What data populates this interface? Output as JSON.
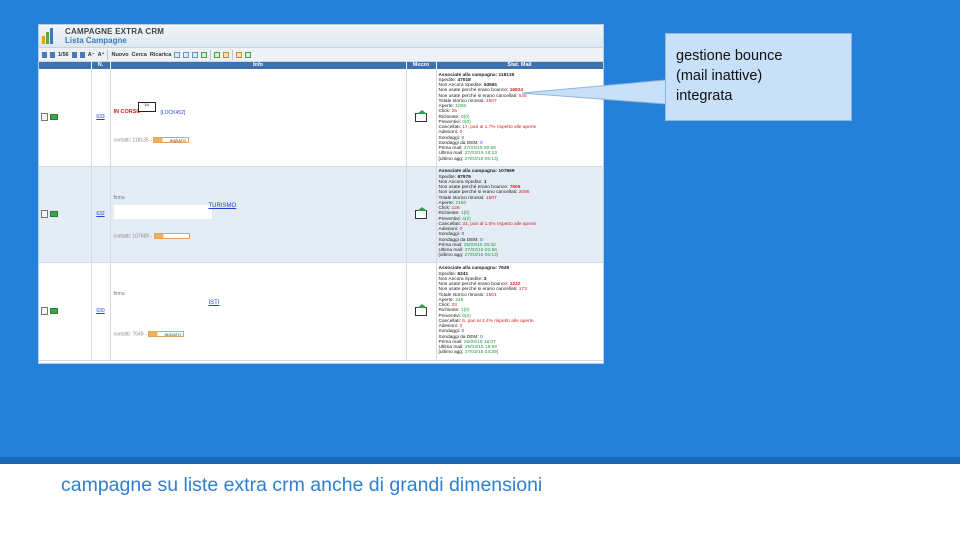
{
  "slide": {
    "callout_lines": [
      "gestione bounce",
      "(mail inattive)",
      "integrata"
    ],
    "caption": "campagne su liste extra crm anche di grandi dimensioni",
    "bg_color": "#2480d8"
  },
  "app": {
    "title": "CAMPAGNE EXTRA CRM",
    "subtitle": "Lista Campagne",
    "toolbar": {
      "page": "1/56",
      "new": "Nuovo",
      "search": "Cerca",
      "reload": "Ricarica"
    },
    "columns": {
      "num": "N.",
      "info": "Info",
      "medium": "Mezzo",
      "stats": "Stat. Mail"
    }
  },
  "rows": [
    {
      "id": "633",
      "status": "IN CORSO",
      "badge": "1/4",
      "lock": "[LOCK452]",
      "contacts": "contatti: 118135 -",
      "bar_label": "INIZIATO",
      "stats": {
        "associated_label": "Associate alla campagna: ",
        "associated": "118135",
        "sent_label": "Spedite: ",
        "sent": "47018",
        "not_sent_label": "Non Ancora Spedite: ",
        "not_sent": "53591",
        "bounce_label": "Non usate perché erano bounce: ",
        "bounce": "16824",
        "cancelled_label": "Non usate perché si erano cancellati: ",
        "cancelled": "545",
        "removed_label": "Totale storico rimossi: ",
        "removed": "1507",
        "opened_label": "Aperte: ",
        "opened": "1006",
        "click_label": "Click: ",
        "click": "25",
        "requests_label": "Richieste: ",
        "requests": "0(0)",
        "quotes_label": "Preventivi: ",
        "quotes": "0(0)",
        "unsub_label": "Cancellati: ",
        "unsub": "17, pari al 1.7% rispetto alle aperte",
        "joins_label": "Adesioni: ",
        "joins": "0",
        "polls_label": "Sondaggi: ",
        "polls": "0",
        "dem_polls_label": "Sondaggi da DEM: ",
        "dem_polls": "0",
        "first_label": "Prima mail: ",
        "first": "27/03/15 00:59",
        "last_label": "Ultima mail: ",
        "last": "27/03/15 18:13",
        "updated_label": "[ultimo agg: ",
        "updated": "27/03/15 06:13]"
      }
    },
    {
      "id": "632",
      "firma": "firma",
      "link_tail": "TURISMO",
      "contacts": "contatti: 107669 -",
      "stats": {
        "associated_label": "Associate alla campagna: ",
        "associated": "107669",
        "sent_label": "Spedite: ",
        "sent": "97979",
        "not_sent_label": "Non Ancora Spedite: ",
        "not_sent": "1",
        "bounce_label": "Non usate perché erano bounce: ",
        "bounce": "7606",
        "cancelled_label": "Non usate perché si erano cancellati: ",
        "cancelled": "2086",
        "removed_label": "Totale storico rimossi: ",
        "removed": "1507",
        "opened_label": "Aperte: ",
        "opened": "2156",
        "click_label": "Click: ",
        "click": "128",
        "requests_label": "Richieste: ",
        "requests": "1(0)",
        "quotes_label": "Preventivi: ",
        "quotes": "4(2)",
        "unsub_label": "Cancellati: ",
        "unsub": "33, pari al 1.5% rispetto alle aperte",
        "joins_label": "Adesioni: ",
        "joins": "0",
        "polls_label": "Sondaggi: ",
        "polls": "0",
        "dem_polls_label": "Sondaggi da DEM: ",
        "dem_polls": "0",
        "first_label": "Prima mail: ",
        "first": "25/03/15 20:32",
        "last_label": "Ultima mail: ",
        "last": "27/03/15 01:56",
        "updated_label": "[ultimo agg: ",
        "updated": "27/03/15 06:13]"
      }
    },
    {
      "id": "630",
      "firma": "firma",
      "link_tail": "ISTI",
      "contacts": "contatti: 7649 -",
      "bar_label": "INIZIATO",
      "stats": {
        "associated_label": "Associate alla campagna: ",
        "associated": "7649",
        "sent_label": "Spedite: ",
        "sent": "6241",
        "not_sent_label": "Non Ancora Spedite: ",
        "not_sent": "3",
        "bounce_label": "Non usate perché erano bounce: ",
        "bounce": "1232",
        "cancelled_label": "Non usate perché si erano cancellati: ",
        "cancelled": "173",
        "removed_label": "Totale storico rimossi: ",
        "removed": "1501",
        "opened_label": "Aperte: ",
        "opened": "248",
        "click_label": "Click: ",
        "click": "23",
        "requests_label": "Richieste: ",
        "requests": "1(0)",
        "quotes_label": "Preventivi: ",
        "quotes": "0(0)",
        "unsub_label": "Cancellati: ",
        "unsub": "6, pari al 2.4% rispetto alle aperte",
        "joins_label": "Adesioni: ",
        "joins": "0",
        "polls_label": "Sondaggi: ",
        "polls": "0",
        "dem_polls_label": "Sondaggi da DEM: ",
        "dem_polls": "0",
        "first_label": "Prima mail: ",
        "first": "25/03/15 18:07",
        "last_label": "Ultima mail: ",
        "last": "25/03/15 19:59",
        "updated_label": "[ultimo agg: ",
        "updated": "27/03/15 03:29]"
      }
    }
  ]
}
